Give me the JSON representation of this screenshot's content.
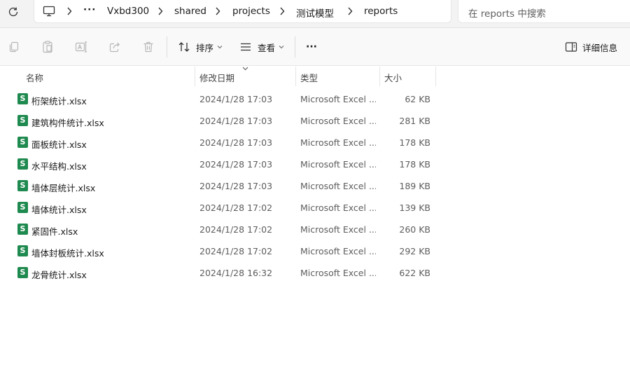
{
  "address": {
    "more": "···",
    "crumbs": [
      "Vxbd300",
      "shared",
      "projects",
      "测试模型",
      "reports"
    ]
  },
  "search": {
    "placeholder": "在 reports 中搜索"
  },
  "toolbar": {
    "sort_label": "排序",
    "view_label": "查看",
    "more_label": "···",
    "details_label": "详细信息"
  },
  "columns": {
    "name": "名称",
    "date": "修改日期",
    "type": "类型",
    "size": "大小"
  },
  "files": [
    {
      "icon": "S",
      "name": "桁架统计.xlsx",
      "date": "2024/1/28 17:03",
      "type": "Microsoft Excel ...",
      "size": "62 KB"
    },
    {
      "icon": "S",
      "name": "建筑构件统计.xlsx",
      "date": "2024/1/28 17:03",
      "type": "Microsoft Excel ...",
      "size": "281 KB"
    },
    {
      "icon": "S",
      "name": "面板统计.xlsx",
      "date": "2024/1/28 17:03",
      "type": "Microsoft Excel ...",
      "size": "178 KB"
    },
    {
      "icon": "S",
      "name": "水平结构.xlsx",
      "date": "2024/1/28 17:03",
      "type": "Microsoft Excel ...",
      "size": "178 KB"
    },
    {
      "icon": "S",
      "name": "墙体层统计.xlsx",
      "date": "2024/1/28 17:03",
      "type": "Microsoft Excel ...",
      "size": "189 KB"
    },
    {
      "icon": "S",
      "name": "墙体统计.xlsx",
      "date": "2024/1/28 17:02",
      "type": "Microsoft Excel ...",
      "size": "139 KB"
    },
    {
      "icon": "S",
      "name": "紧固件.xlsx",
      "date": "2024/1/28 17:02",
      "type": "Microsoft Excel ...",
      "size": "260 KB"
    },
    {
      "icon": "S",
      "name": "墙体封板统计.xlsx",
      "date": "2024/1/28 17:02",
      "type": "Microsoft Excel ...",
      "size": "292 KB"
    },
    {
      "icon": "S",
      "name": "龙骨统计.xlsx",
      "date": "2024/1/28 16:32",
      "type": "Microsoft Excel ...",
      "size": "622 KB"
    }
  ]
}
